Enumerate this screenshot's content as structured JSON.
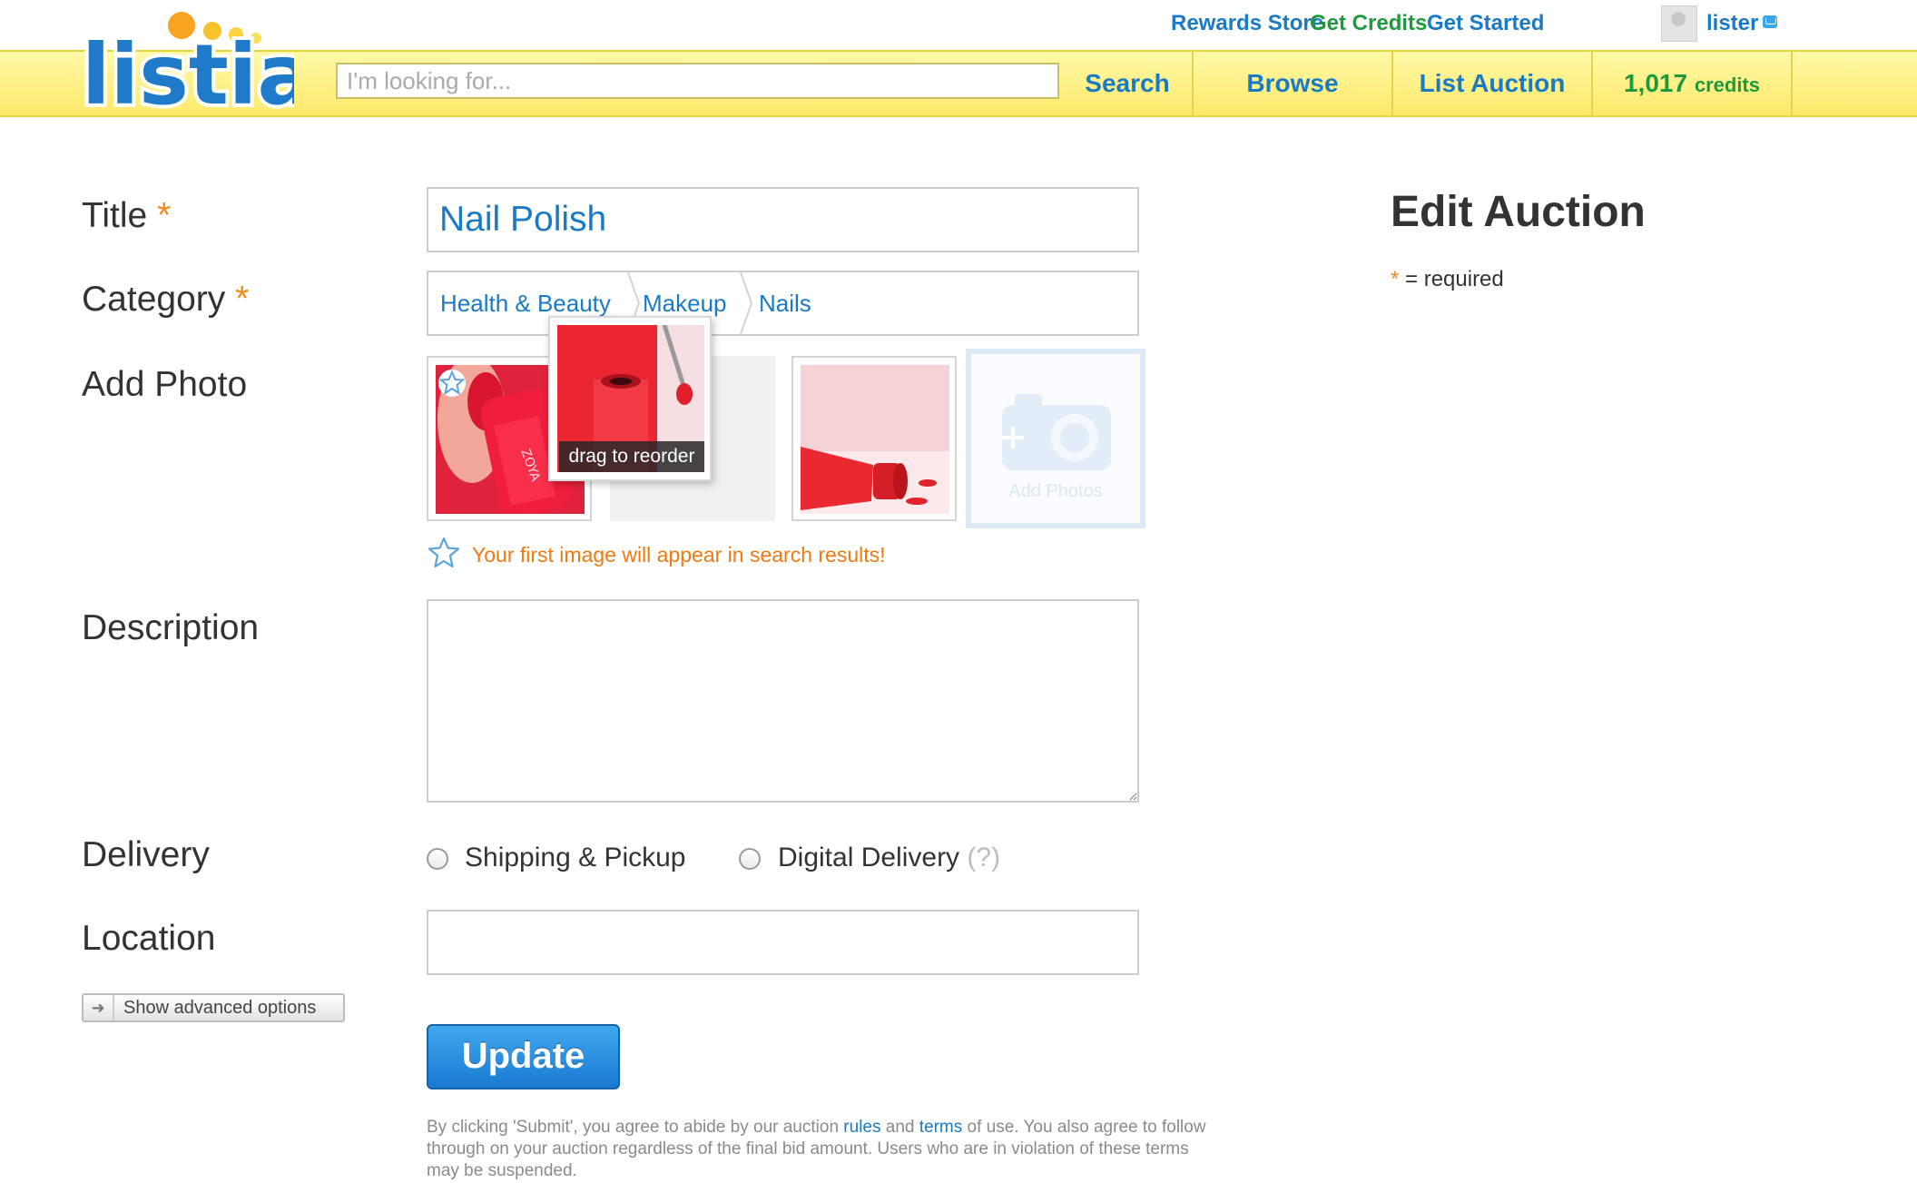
{
  "header": {
    "logo_text": "listia",
    "links": {
      "rewards_store": "Rewards Store",
      "get_credits": "Get Credits",
      "get_started": "Get Started",
      "username": "lister"
    },
    "search": {
      "placeholder": "I'm looking for...",
      "button": "Search"
    },
    "nav": {
      "browse": "Browse",
      "list_auction": "List Auction",
      "credits_value": "1,017",
      "credits_unit": "credits"
    }
  },
  "form": {
    "title": {
      "label": "Title",
      "required_mark": "*",
      "value": "Nail Polish"
    },
    "category": {
      "label": "Category",
      "required_mark": "*",
      "path": [
        "Health & Beauty",
        "Makeup",
        "Nails"
      ]
    },
    "photos": {
      "label": "Add Photo",
      "drag_tooltip": "drag to reorder",
      "add_label": "Add Photos",
      "tip": "Your first image will appear in search results!"
    },
    "description": {
      "label": "Description",
      "value": ""
    },
    "delivery": {
      "label": "Delivery",
      "options": [
        "Shipping & Pickup",
        "Digital Delivery"
      ],
      "help": "(?)"
    },
    "location": {
      "label": "Location",
      "value": ""
    },
    "advanced_button": "Show advanced options",
    "submit": "Update",
    "legal": {
      "part1": "By clicking 'Submit', you agree to abide by our auction ",
      "rules": "rules",
      "and": " and ",
      "terms": "terms",
      "part2": " of use. You also agree to follow through on your auction regardless of the final bid amount. Users who are in violation of these terms may be suspended."
    }
  },
  "sidebar": {
    "heading": "Edit Auction",
    "required_mark": "*",
    "required_note": " = required"
  },
  "colors": {
    "link_blue": "#1a7ac4",
    "credits_green": "#1e9a3c",
    "required_orange": "#f08a1c",
    "header_yellow": "#fde96a"
  }
}
